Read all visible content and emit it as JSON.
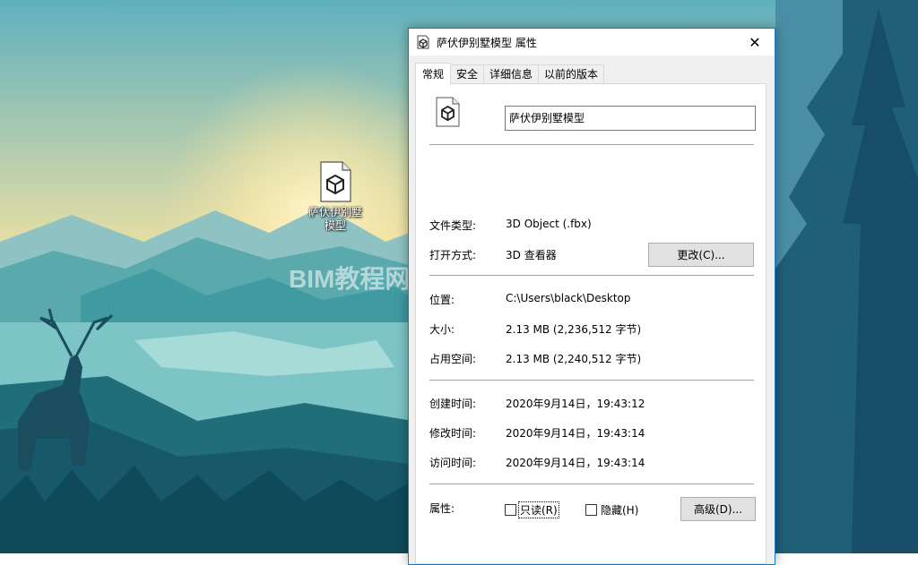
{
  "desktop": {
    "icon_label": "萨伏伊别墅模型",
    "watermark": "BIM教程网|www.ibim.com"
  },
  "dialog": {
    "title": "萨伏伊别墅模型 属性",
    "close_glyph": "✕",
    "tabs": [
      {
        "label": "常规",
        "active": true
      },
      {
        "label": "安全",
        "active": false
      },
      {
        "label": "详细信息",
        "active": false
      },
      {
        "label": "以前的版本",
        "active": false
      }
    ],
    "file_name": "萨伏伊别墅模型",
    "file_type_label": "文件类型:",
    "file_type_value": "3D Object (.fbx)",
    "open_with_label": "打开方式:",
    "open_with_value": "3D 查看器",
    "change_button": "更改(C)...",
    "location_label": "位置:",
    "location_value": "C:\\Users\\black\\Desktop",
    "size_label": "大小:",
    "size_value": "2.13 MB (2,236,512 字节)",
    "size_on_disk_label": "占用空间:",
    "size_on_disk_value": "2.13 MB (2,240,512 字节)",
    "created_label": "创建时间:",
    "created_value": "2020年9月14日，19:43:12",
    "modified_label": "修改时间:",
    "modified_value": "2020年9月14日，19:43:14",
    "accessed_label": "访问时间:",
    "accessed_value": "2020年9月14日，19:43:14",
    "attributes_label": "属性:",
    "readonly_label": "只读(R)",
    "readonly_checked": false,
    "hidden_label": "隐藏(H)",
    "hidden_checked": false,
    "advanced_button": "高级(D)...",
    "accent_color": "#1979ca"
  }
}
